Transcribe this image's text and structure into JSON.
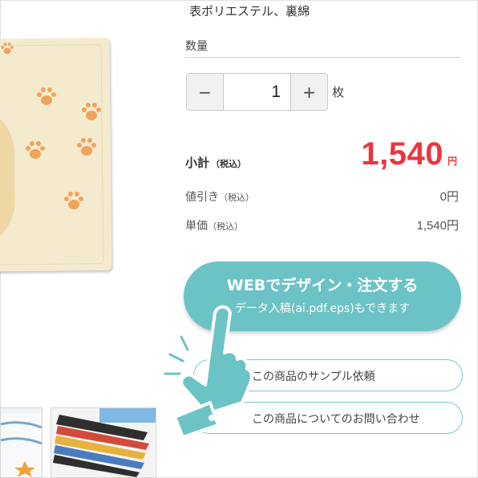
{
  "product": {
    "material": "表ポリエステル、裏綿"
  },
  "quantity": {
    "label": "数量",
    "minus": "−",
    "value": "1",
    "plus": "+",
    "unit": "枚"
  },
  "price": {
    "subtotal_label": "小計",
    "tax_note": "（税込）",
    "subtotal_value": "1,540",
    "yen": "円",
    "discount_label": "値引き",
    "discount_tax_note": "（税込）",
    "discount_value": "0円",
    "unit_price_label": "単価",
    "unit_price_tax_note": "（税込）",
    "unit_price_value": "1,540円"
  },
  "actions": {
    "web_design_main": "WEBでデザイン・注文する",
    "web_design_sub": "データ入稿(ai.pdf.eps)もできます",
    "sample_request": "この商品のサンプル依頼",
    "inquiry": "この商品についてのお問い合わせ"
  },
  "colors": {
    "accent_teal": "#6cc3c5",
    "price_red": "#e8363f",
    "towel_cream": "#f4ebcf",
    "paw_orange": "#f0a35c"
  },
  "icons": {
    "cursor": "pointing-hand-icon",
    "paw": "paw-print-icon"
  }
}
